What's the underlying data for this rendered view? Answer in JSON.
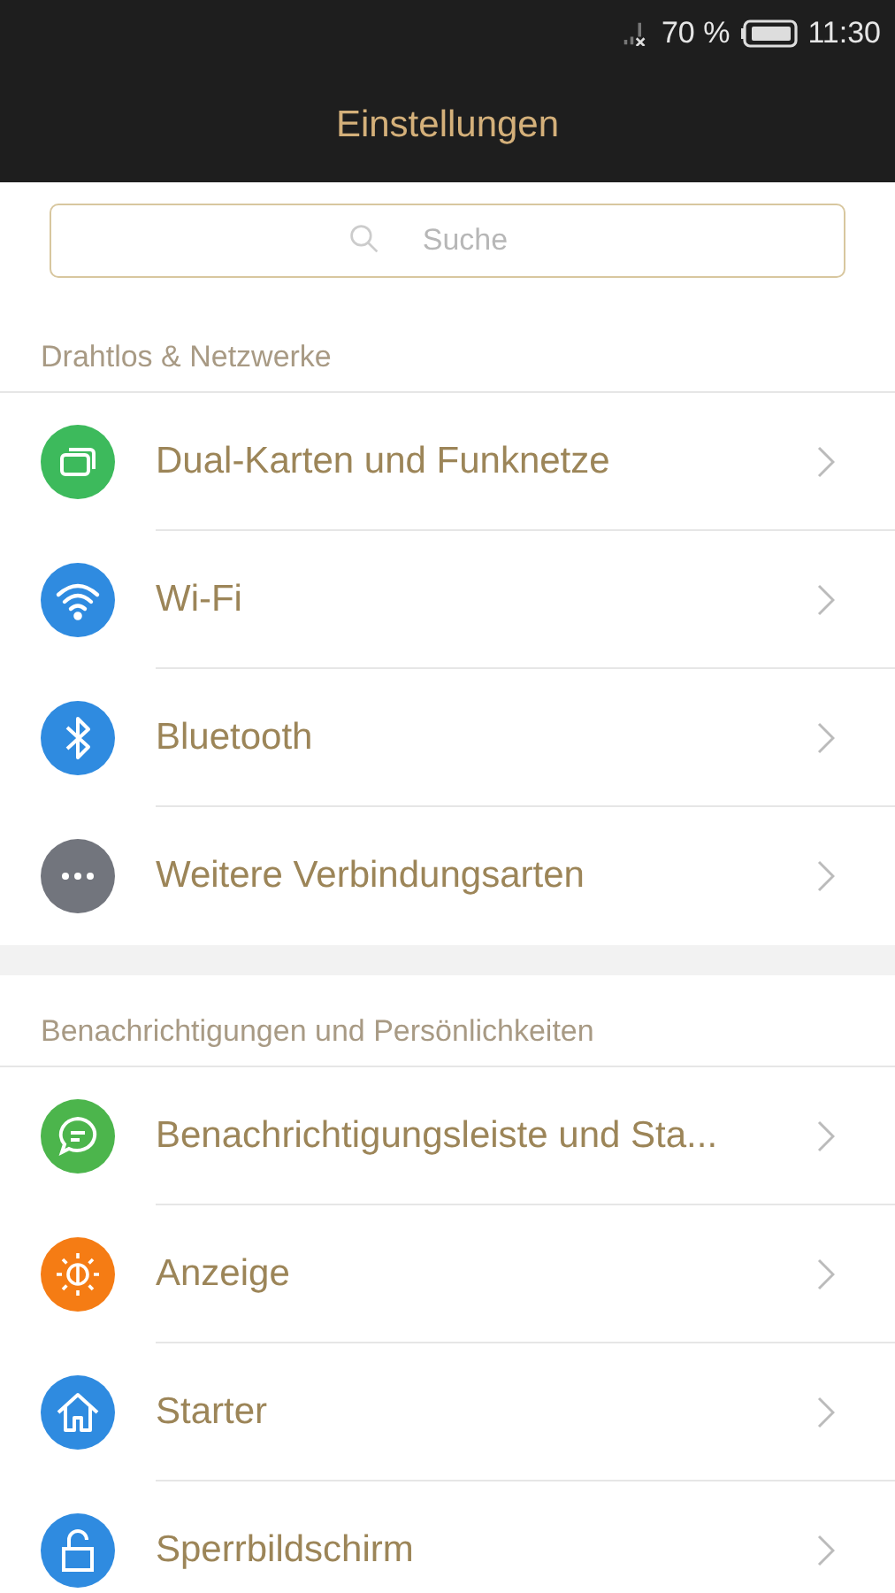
{
  "status_bar": {
    "battery_percent": "70 %",
    "time": "11:30"
  },
  "title": "Einstellungen",
  "search": {
    "placeholder": "Suche"
  },
  "sections": [
    {
      "header": "Drahtlos & Netzwerke",
      "items": [
        {
          "label": "Dual-Karten und Funknetze",
          "kind": "sim",
          "color": "#3dba5c"
        },
        {
          "label": "Wi-Fi",
          "kind": "wifi",
          "color": "#2f8be0"
        },
        {
          "label": "Bluetooth",
          "kind": "bluetooth",
          "color": "#2f8be0"
        },
        {
          "label": "Weitere Verbindungsarten",
          "kind": "more",
          "color": "#72757d"
        }
      ]
    },
    {
      "header": "Benachrichtigungen und Persönlichkeiten",
      "items": [
        {
          "label": "Benachrichtigungsleiste und Sta...",
          "kind": "message",
          "color": "#4cb54c"
        },
        {
          "label": "Anzeige",
          "kind": "brightness",
          "color": "#f57c14"
        },
        {
          "label": "Starter",
          "kind": "home",
          "color": "#2f8be0"
        },
        {
          "label": "Sperrbildschirm",
          "kind": "lock",
          "color": "#2f8be0"
        }
      ]
    }
  ]
}
